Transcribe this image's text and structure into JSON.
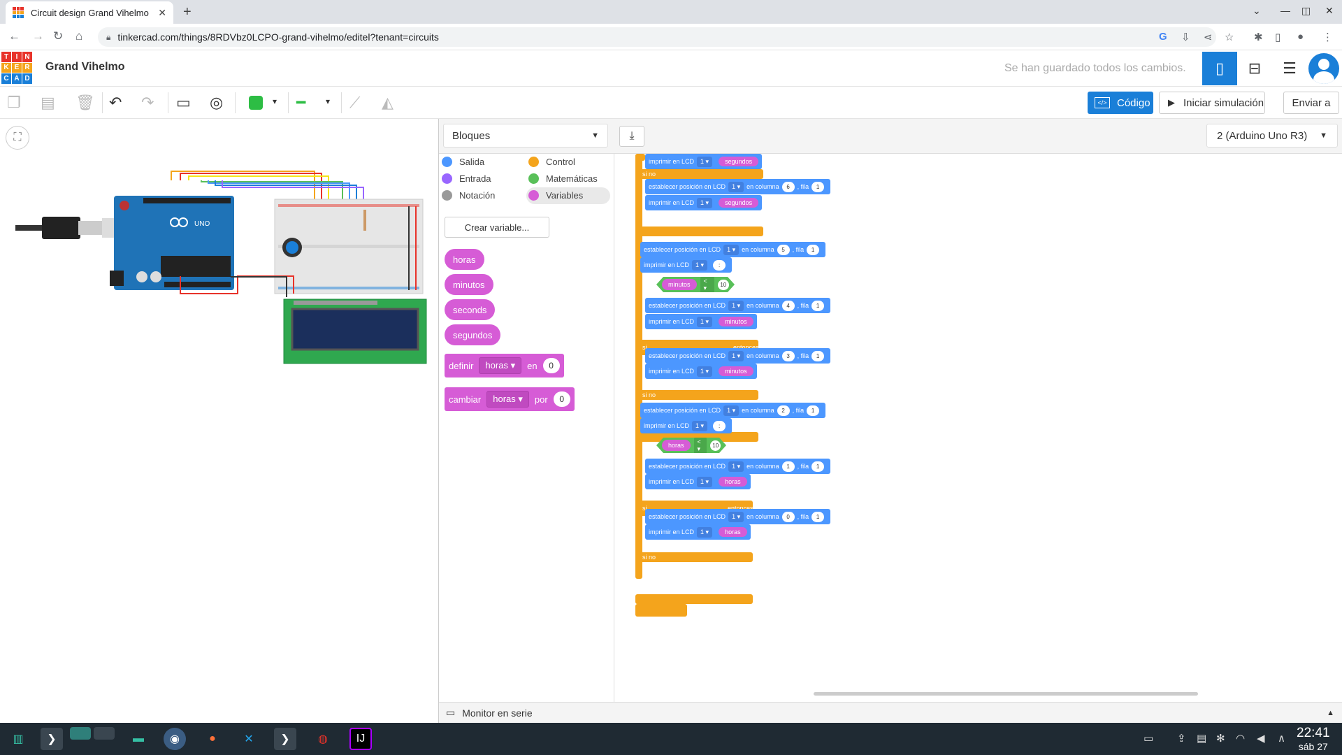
{
  "browser": {
    "tab_title": "Circuit design Grand Vihelmo",
    "tab_close": "✕",
    "new_tab": "+",
    "url": "tinkercad.com/things/8RDVbz0LCPO-grand-vihelmo/editel?tenant=circuits"
  },
  "app": {
    "logo_letters": [
      "T",
      "I",
      "N",
      "K",
      "E",
      "R",
      "C",
      "A",
      "D"
    ],
    "logo_colors": [
      "#e8332a",
      "#e8332a",
      "#e8332a",
      "#f4a41c",
      "#f4a41c",
      "#f4a41c",
      "#1a7fd8",
      "#1a7fd8",
      "#1a7fd8"
    ],
    "project_name": "Grand Vihelmo",
    "save_status": "Se han guardado todos los cambios.",
    "accent": "#1a7fd8"
  },
  "toolbar": {
    "codigo_label": "Código",
    "sim_label": "Iniciar simulación",
    "enviar_label": "Enviar a",
    "color_swatch": "#2dbd44"
  },
  "code": {
    "mode": "Bloques",
    "device": "2 (Arduino Uno R3)",
    "categories": [
      {
        "label": "Salida",
        "color": "#4c97ff"
      },
      {
        "label": "Control",
        "color": "#f4a41c"
      },
      {
        "label": "Entrada",
        "color": "#9966ff"
      },
      {
        "label": "Matemáticas",
        "color": "#59c059"
      },
      {
        "label": "Notación",
        "color": "#999999"
      },
      {
        "label": "Variables",
        "color": "#d65cd6"
      }
    ],
    "create_variable": "Crear variable...",
    "variables": [
      "horas",
      "minutos",
      "seconds",
      "segundos"
    ],
    "set_block": {
      "label": "definir",
      "var": "horas",
      "mid": "en",
      "value": "0"
    },
    "change_block": {
      "label": "cambiar",
      "var": "horas",
      "mid": "por",
      "value": "0"
    },
    "serial_monitor": "Monitor en serie"
  },
  "workspace": {
    "txt_print": "imprimir en LCD",
    "txt_setpos": "establecer posición en LCD",
    "txt_col": "en columna",
    "txt_row": ", fila",
    "txt_one": "1",
    "txt_else": "si no",
    "txt_if": "si",
    "txt_then": "entonces",
    "txt_lt": "<",
    "txt_ten": "10",
    "txt_colon": ":",
    "var_segundos": "segundos",
    "var_minutos": "minutos",
    "var_horas": "horas",
    "col_6": "6",
    "col_5": "5",
    "col_4": "4",
    "col_3": "3",
    "col_2": "2"
  },
  "taskbar": {
    "time": "22:41",
    "date": "sáb 27"
  }
}
